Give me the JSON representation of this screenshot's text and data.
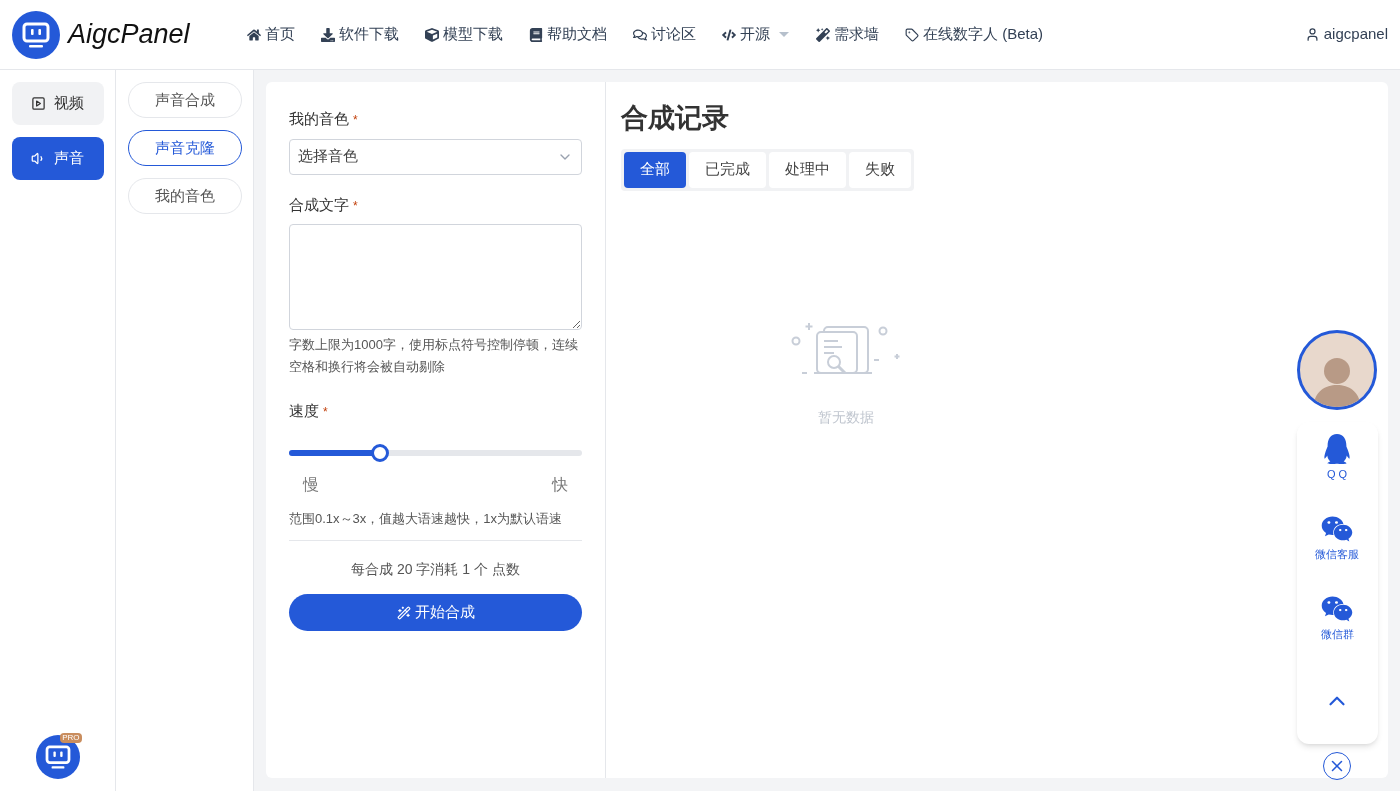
{
  "header": {
    "brand": "AigcPanel",
    "nav": [
      {
        "label": "首页",
        "kind": "home"
      },
      {
        "label": "软件下载",
        "kind": "download"
      },
      {
        "label": "模型下载",
        "kind": "cube"
      },
      {
        "label": "帮助文档",
        "kind": "book"
      },
      {
        "label": "讨论区",
        "kind": "chat"
      },
      {
        "label": "开源",
        "kind": "code",
        "dropdown": true
      },
      {
        "label": "需求墙",
        "kind": "wand"
      },
      {
        "label": "在线数字人 (Beta)",
        "kind": "tag"
      }
    ],
    "user": "aigcpanel"
  },
  "sidebar": {
    "items": [
      {
        "label": "视频",
        "kind": "video",
        "selected": false
      },
      {
        "label": "声音",
        "kind": "sound",
        "selected": true
      }
    ],
    "pro_badge": "PRO"
  },
  "subnav": {
    "items": [
      {
        "label": "声音合成",
        "selected": false
      },
      {
        "label": "声音克隆",
        "selected": true
      },
      {
        "label": "我的音色",
        "selected": false
      }
    ]
  },
  "form": {
    "voice": {
      "label": "我的音色",
      "required_mark": "*",
      "placeholder": "选择音色"
    },
    "text": {
      "label": "合成文字",
      "required_mark": "*",
      "hint": "字数上限为1000字，使用标点符号控制停顿，连续空格和换行将会被自动剔除"
    },
    "speed": {
      "label": "速度",
      "required_mark": "*",
      "level": 0.31,
      "min_label": "慢",
      "max_label": "快",
      "hint": "范围0.1x～3x，值越大语速越快，1x为默认语速"
    },
    "cost": "每合成 20 字消耗 1 个 点数",
    "submit": "开始合成"
  },
  "records": {
    "title": "合成记录",
    "tabs": [
      {
        "label": "全部",
        "selected": true
      },
      {
        "label": "已完成",
        "selected": false
      },
      {
        "label": "处理中",
        "selected": false
      },
      {
        "label": "失败",
        "selected": false
      }
    ],
    "empty": "暂无数据"
  },
  "float_panel": {
    "items": [
      {
        "label": "Q Q",
        "kind": "qq"
      },
      {
        "label": "微信客服",
        "kind": "wechat"
      },
      {
        "label": "微信群",
        "kind": "wechat"
      }
    ]
  }
}
